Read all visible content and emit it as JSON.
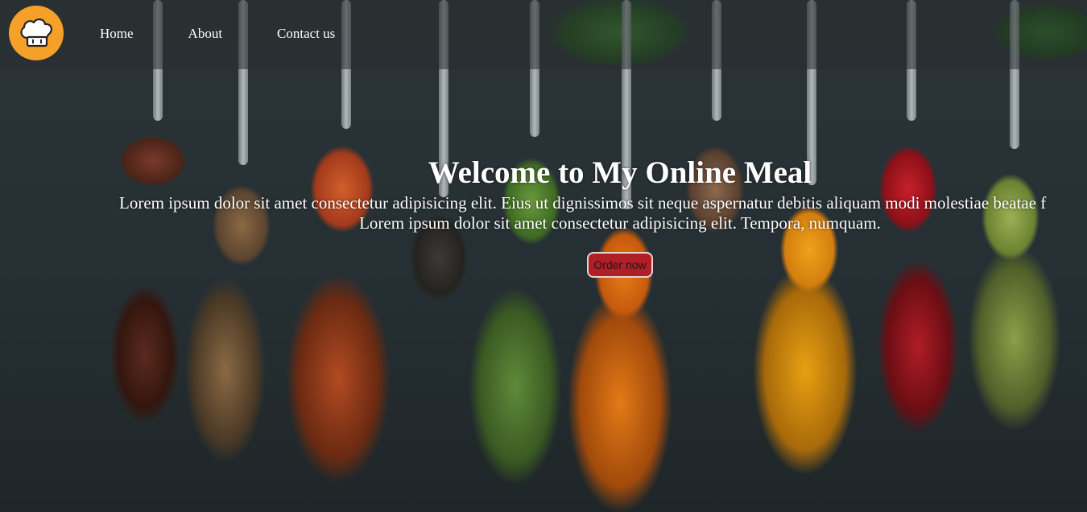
{
  "brand": {
    "logo_icon": "chef-hat-icon",
    "logo_color": "#f5a028"
  },
  "nav": {
    "items": [
      {
        "label": "Home"
      },
      {
        "label": "About"
      },
      {
        "label": "Contact us"
      }
    ]
  },
  "hero": {
    "background": "spice-spoons-photo",
    "title": "Welcome to My Online Meal",
    "paragraph_line1": "Lorem ipsum dolor sit amet consectetur adipisicing elit. Eius ut dignissimos sit neque aspernatur debitis aliquam modi molestiae beatae f",
    "paragraph_line2": "Lorem ipsum dolor sit amet consectetur adipisicing elit. Tempora, numquam.",
    "cta_label": "Order now",
    "cta_color": "#b01f26"
  }
}
